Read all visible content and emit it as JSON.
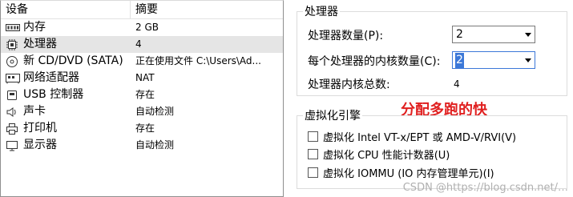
{
  "table": {
    "headers": [
      "设备",
      "摘要"
    ],
    "rows": [
      {
        "device": "内存",
        "summary": "2 GB",
        "icon": "memory-icon",
        "selected": false
      },
      {
        "device": "处理器",
        "summary": "4",
        "icon": "processor-icon",
        "selected": true
      },
      {
        "device": "新 CD/DVD (SATA)",
        "summary": "正在使用文件 C:\\Users\\Ad...",
        "icon": "cd-dvd-icon",
        "selected": false
      },
      {
        "device": "网络适配器",
        "summary": "NAT",
        "icon": "network-adapter-icon",
        "selected": false
      },
      {
        "device": "USB 控制器",
        "summary": "存在",
        "icon": "usb-icon",
        "selected": false
      },
      {
        "device": "声卡",
        "summary": "自动检测",
        "icon": "speaker-icon",
        "selected": false
      },
      {
        "device": "打印机",
        "summary": "存在",
        "icon": "printer-icon",
        "selected": false
      },
      {
        "device": "显示器",
        "summary": "自动检测",
        "icon": "monitor-icon",
        "selected": false
      }
    ]
  },
  "processors": {
    "group_title": "处理器",
    "count_label": "处理器数量(P):",
    "count_value": "2",
    "cores_label": "每个处理器的内核数量(C):",
    "cores_value": "2",
    "total_label": "处理器内核总数:",
    "total_value": "4"
  },
  "virtualization": {
    "group_title": "虚拟化引擎",
    "options": [
      {
        "label": "虚拟化 Intel VT-x/EPT 或 AMD-V/RVI(V)",
        "checked": false
      },
      {
        "label": "虚拟化 CPU 性能计数器(U)",
        "checked": false
      },
      {
        "label": "虚拟化 IOMMU (IO 内存管理单元)(I)",
        "checked": false
      }
    ]
  },
  "annotation": "分配多跑的快",
  "watermark": "CSDN @https://blog.csdn.net/…",
  "colors": {
    "annotation": "#e02020",
    "selection": "#3c78d8",
    "row_selected": "#e5e5e5"
  }
}
